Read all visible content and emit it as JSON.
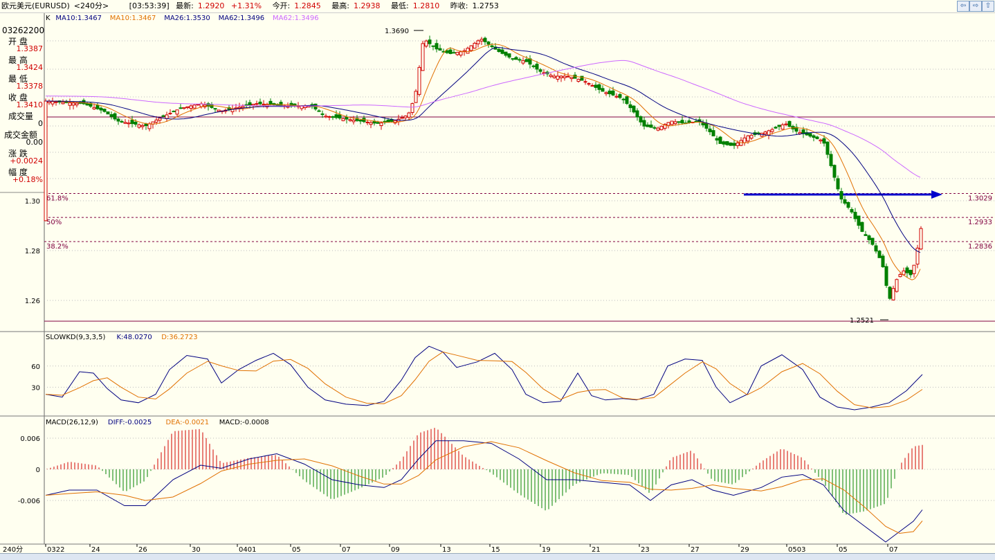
{
  "title": {
    "symbol": "欧元美元(EURUSD)",
    "period": "<240分>",
    "time": "[03:53:39]",
    "latest_label": "最新:",
    "latest": "1.2920",
    "change_pct": "+1.31%",
    "open_label": "今开:",
    "open": "1.2845",
    "high_label": "最高:",
    "high": "1.2938",
    "low_label": "最低:",
    "low": "1.2810",
    "prev_label": "昨收:",
    "prev": "1.2753",
    "buttons": [
      "⇦",
      "⇨",
      "⇧"
    ]
  },
  "info_panel": {
    "datetime": "03262200",
    "items": [
      {
        "label": "开  盘",
        "value": "1.3387",
        "color": "#d00000"
      },
      {
        "label": "最  高",
        "value": "1.3424",
        "color": "#d00000"
      },
      {
        "label": "最  低",
        "value": "1.3378",
        "color": "#d00000"
      },
      {
        "label": "收  盘",
        "value": "1.3410",
        "color": "#d00000"
      },
      {
        "label": "成交量",
        "value": "0",
        "color": "#000000"
      },
      {
        "label": "成交金额",
        "value": "0.00",
        "color": "#000000"
      },
      {
        "label": "涨  跌",
        "value": "+0.0024",
        "color": "#d00000"
      },
      {
        "label": "幅  度",
        "value": "+0.18%",
        "color": "#d00000"
      }
    ]
  },
  "ma_legend": [
    {
      "text": "K",
      "color": "#000000"
    },
    {
      "text": "MA10:1.3467",
      "color": "#000080"
    },
    {
      "text": "MA10:1.3467",
      "color": "#e07000"
    },
    {
      "text": "MA26:1.3530",
      "color": "#000080"
    },
    {
      "text": "MA62:1.3496",
      "color": "#000080"
    },
    {
      "text": "MA62:1.3496",
      "color": "#cc66ff"
    }
  ],
  "kd_legend": [
    {
      "text": "SLOWKD(9,3,3,5)",
      "color": "#000000"
    },
    {
      "text": "K:48.0270",
      "color": "#000080"
    },
    {
      "text": "D:36.2723",
      "color": "#e07000"
    }
  ],
  "macd_legend": [
    {
      "text": "MACD(26,12,9)",
      "color": "#000000"
    },
    {
      "text": "DIFF:-0.0025",
      "color": "#000080"
    },
    {
      "text": "DEA:-0.0021",
      "color": "#e07000"
    },
    {
      "text": "MACD:-0.0008",
      "color": "#000000"
    }
  ],
  "price_axis": [
    "1.30",
    "1.28",
    "1.26"
  ],
  "kd_axis": [
    "60",
    "30"
  ],
  "macd_axis": [
    "0.006",
    "0",
    "-0.006"
  ],
  "fib_levels": [
    {
      "pct": "61.8%",
      "value": "1.3029"
    },
    {
      "pct": "50%",
      "value": "1.2933"
    },
    {
      "pct": "38.2%",
      "value": "1.2836"
    }
  ],
  "annotations": {
    "high_mark": "1.3690",
    "low_mark": "1.2521"
  },
  "x_axis": {
    "period_label": "240分",
    "ticks": [
      "0322",
      "24",
      "26",
      "30",
      "0401",
      "05",
      "07",
      "09",
      "13",
      "15",
      "19",
      "21",
      "23",
      "27",
      "29",
      "0503",
      "05",
      "07"
    ]
  },
  "colors": {
    "up": "#d00000",
    "down": "#008000",
    "ma10": "#e07000",
    "ma26": "#000080",
    "ma62": "#cc66ff",
    "arrow": "#0000cc",
    "bg": "#fffff0"
  }
}
